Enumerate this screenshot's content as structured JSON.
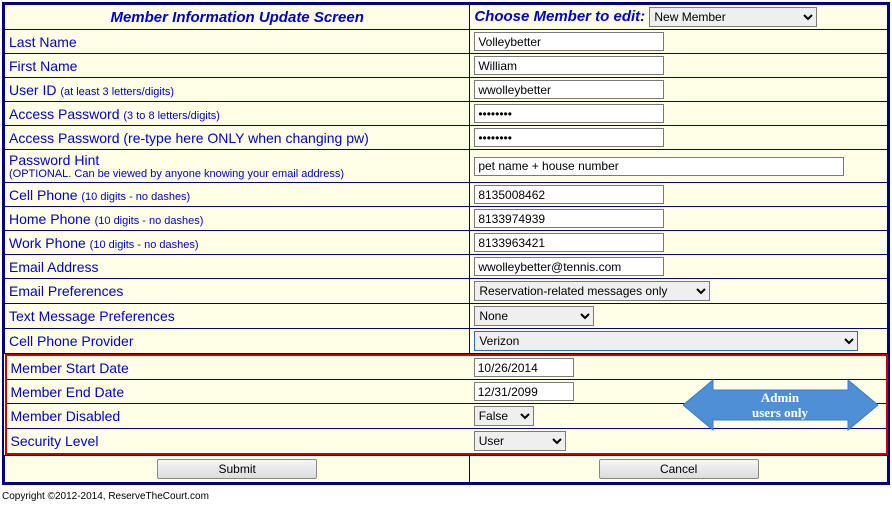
{
  "header": {
    "title": "Member Information Update Screen",
    "choose_label": "Choose Member to edit:",
    "choose_value": "New Member"
  },
  "labels": {
    "last_name": "Last Name",
    "first_name": "First Name",
    "user_id": "User ID",
    "user_id_hint": "(at least 3 letters/digits)",
    "password": "Access Password",
    "password_hint": "(3 to 8 letters/digits)",
    "password2": "Access Password (re-type here ONLY when changing pw)",
    "pw_hint": "Password Hint",
    "pw_hint_sub": "(OPTIONAL. Can be viewed by anyone knowing your email address)",
    "cell_phone": "Cell Phone",
    "cell_phone_hint": "(10 digits - no dashes)",
    "home_phone": "Home Phone",
    "home_phone_hint": "(10 digits - no dashes)",
    "work_phone": "Work Phone",
    "work_phone_hint": "(10 digits - no dashes)",
    "email": "Email Address",
    "email_pref": "Email Preferences",
    "text_pref": "Text Message Preferences",
    "provider": "Cell Phone Provider",
    "start_date": "Member Start Date",
    "end_date": "Member End Date",
    "disabled": "Member Disabled",
    "sec_level": "Security Level"
  },
  "values": {
    "last_name": "Volleybetter",
    "first_name": "William",
    "user_id": "wwolleybetter",
    "password": "••••••••",
    "password2": "••••••••",
    "pw_hint": "pet name + house number",
    "cell_phone": "8135008462",
    "home_phone": "8133974939",
    "work_phone": "8133963421",
    "email": "wwolleybetter@tennis.com",
    "email_pref": "Reservation-related messages only",
    "text_pref": "None",
    "provider": "Verizon",
    "start_date": "10/26/2014",
    "end_date": "12/31/2099",
    "disabled": "False",
    "sec_level": "User"
  },
  "buttons": {
    "submit": "Submit",
    "cancel": "Cancel"
  },
  "callout": {
    "line1": "Admin",
    "line2": "users only"
  },
  "footer": {
    "copyright": "Copyright ©2012-2014, ReserveTheCourt.com"
  }
}
